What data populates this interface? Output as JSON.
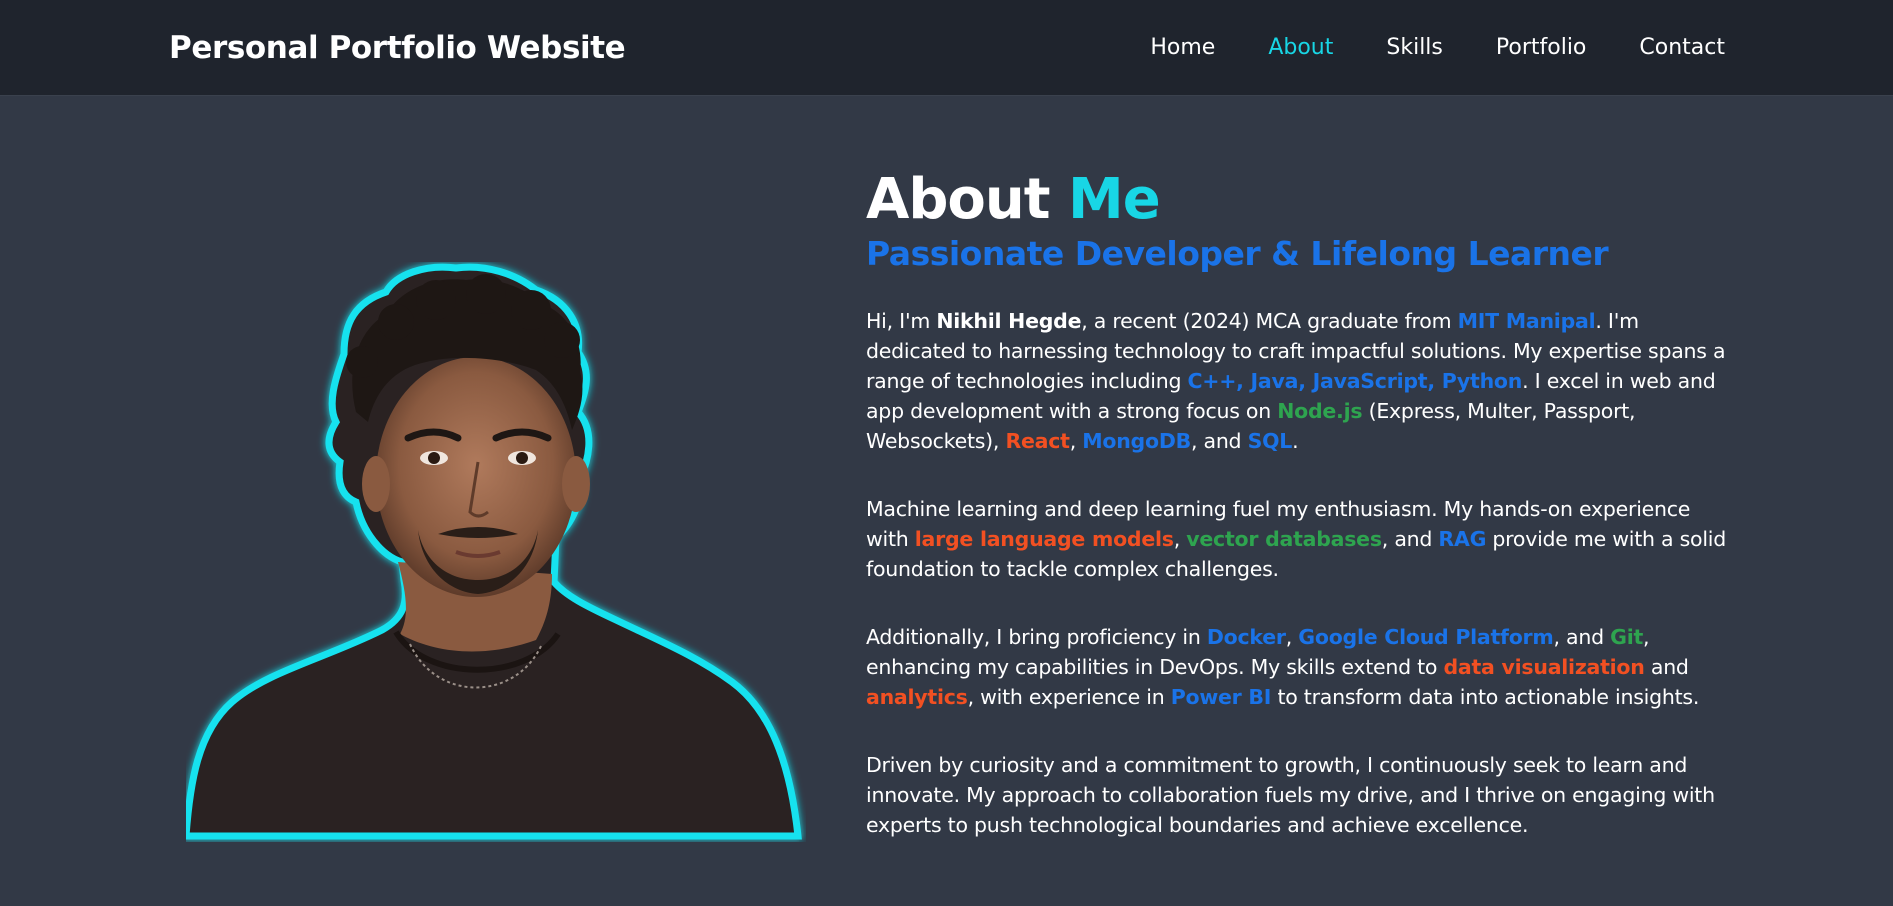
{
  "header": {
    "logo": "Personal Portfolio Website",
    "nav": [
      {
        "label": "Home"
      },
      {
        "label": "About",
        "active": true
      },
      {
        "label": "Skills"
      },
      {
        "label": "Portfolio"
      },
      {
        "label": "Contact"
      }
    ]
  },
  "about": {
    "heading_main": "About",
    "heading_accent": "Me",
    "subheading": "Passionate Developer & Lifelong Learner",
    "p1": {
      "t1": "Hi, I'm ",
      "name": "Nikhil Hegde",
      "t2": ", a recent (2024) MCA graduate from ",
      "school": "MIT Manipal",
      "t3": ". I'm dedicated to harnessing technology to craft impactful solutions. My expertise spans a range of technologies including ",
      "langs": "C++, Java, JavaScript, Python",
      "t4": ". I excel in web and app development with a strong focus on ",
      "node": "Node.js",
      "t5": " (Express, Multer, Passport, Websockets), ",
      "react": "React",
      "t6": ", ",
      "mongo": "MongoDB",
      "t7": ", and ",
      "sql": "SQL",
      "t8": "."
    },
    "p2": {
      "t1": "Machine learning and deep learning fuel my enthusiasm. My hands-on experience with ",
      "llm": "large language models",
      "t2": ", ",
      "vdb": "vector databases",
      "t3": ", and ",
      "rag": "RAG",
      "t4": " provide me with a solid foundation to tackle complex challenges."
    },
    "p3": {
      "t1": "Additionally, I bring proficiency in ",
      "docker": "Docker",
      "t2": ", ",
      "gcp": "Google Cloud Platform",
      "t3": ", and ",
      "git": "Git",
      "t4": ", enhancing my capabilities in DevOps. My skills extend to ",
      "dataviz": "data visualization",
      "t5": " and ",
      "analytics": "analytics",
      "t6": ", with experience in ",
      "powerbi": "Power BI",
      "t7": " to transform data into actionable insights."
    },
    "p4": "Driven by curiosity and a commitment to growth, I continuously seek to learn and innovate. My approach to collaboration fuels my drive, and I thrive on engaging with experts to push technological boundaries and achieve excellence."
  },
  "colors": {
    "accent": "#18d6e5",
    "blue": "#1a73e8",
    "green": "#2ea44f",
    "orange": "#f25022",
    "background": "#323946",
    "header": "#1f242d"
  }
}
